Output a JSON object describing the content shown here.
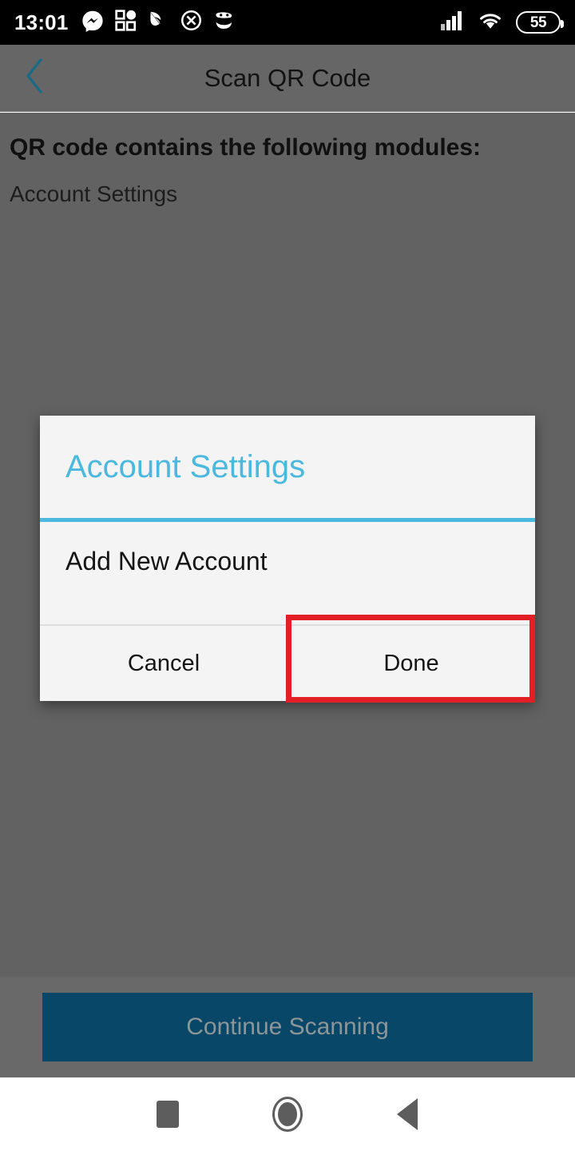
{
  "status_bar": {
    "clock": "13:01",
    "left_icons": [
      {
        "name": "messenger-icon",
        "label": "Messenger"
      },
      {
        "name": "app-grid-icon",
        "label": "App grid"
      },
      {
        "name": "paper-plane-icon",
        "label": "Navigation"
      },
      {
        "name": "circle-x-icon",
        "label": "Cancel"
      },
      {
        "name": "face-icon",
        "label": "App"
      }
    ],
    "right_icons": [
      {
        "name": "cellular-signal-icon",
        "label": "Signal"
      },
      {
        "name": "wifi-icon",
        "label": "Wi-Fi"
      }
    ],
    "battery_level": "55",
    "background_color": "#000000",
    "foreground_color": "#ffffff"
  },
  "app_bar": {
    "title": "Scan QR Code",
    "back_icon": "chevron-left-icon",
    "back_icon_color": "#1b6a85",
    "background_color": "#666666"
  },
  "content": {
    "heading": "QR code contains the following modules:",
    "modules": [
      "Account Settings"
    ],
    "background_color": "#626262"
  },
  "bottom_panel": {
    "continue_button_label": "Continue Scanning",
    "continue_button_color": "#084767",
    "continue_button_text_color": "#8c9699"
  },
  "dialog": {
    "title": "Account Settings",
    "title_color": "#4bb8dd",
    "divider_color": "#4bb8dd",
    "items": [
      "Add New Account"
    ],
    "cancel_label": "Cancel",
    "done_label": "Done",
    "highlight_color": "#e41e26",
    "highlighted_button": "Done",
    "background_color": "#f4f4f4"
  },
  "nav_bar": {
    "recents_icon": "square-icon",
    "home_icon": "circle-icon",
    "back_icon": "triangle-left-icon",
    "background_color": "#ffffff",
    "icon_color": "#5d5d5d"
  }
}
